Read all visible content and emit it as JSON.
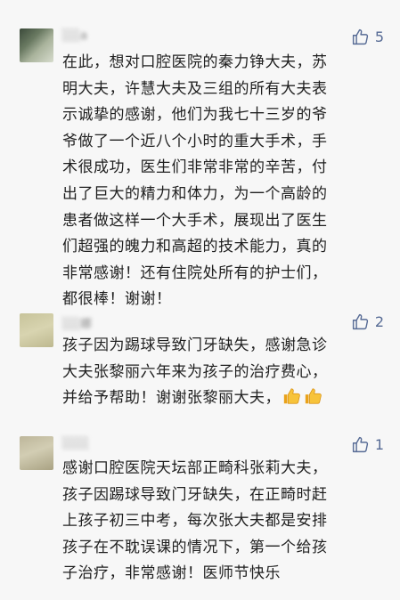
{
  "comments": [
    {
      "name": "░░a",
      "likes": "5",
      "lines": [
        "在此，想对口腔医院的秦力铮大夫，苏",
        "明大夫，许慧大夫及三组的所有大夫表",
        "示诚挚的感谢，他们为我七十三岁的爷",
        "爷做了一个近八个小时的重大手术，手",
        "术很成功，医生们非常非常的辛苦，付",
        "出了巨大的精力和体力，为一个高龄的",
        "患者做这样一个大手术，展现出了医生",
        "们超强的魄力和高超的技术能力，真的",
        "非常感谢！还有住院处所有的护士们，",
        "都很棒！谢谢！"
      ]
    },
    {
      "name": "░░娜",
      "likes": "2",
      "lines": [
        "孩子因为踢球导致门牙缺失，感谢急诊",
        "大夫张黎丽六年来为孩子的治疗费心，",
        "并给予帮助！谢谢张黎丽大夫，"
      ],
      "emoji": "thumbs-up-emoji"
    },
    {
      "name": "░░░",
      "likes": "1",
      "lines": [
        "感谢口腔医院天坛部正畸科张莉大夫，",
        "孩子因踢球导致门牙缺失，在正畸时赶",
        "上孩子初三中考，每次张大夫都是安排",
        "孩子在不耽误课的情况下，第一个给孩",
        "子治疗，非常感谢！医师节快乐"
      ]
    }
  ],
  "colors": {
    "like": "#576b95",
    "background": "#f7f7f7",
    "text": "#1f1f1f"
  },
  "icons": {
    "like": "thumbs-up-outline-icon"
  }
}
